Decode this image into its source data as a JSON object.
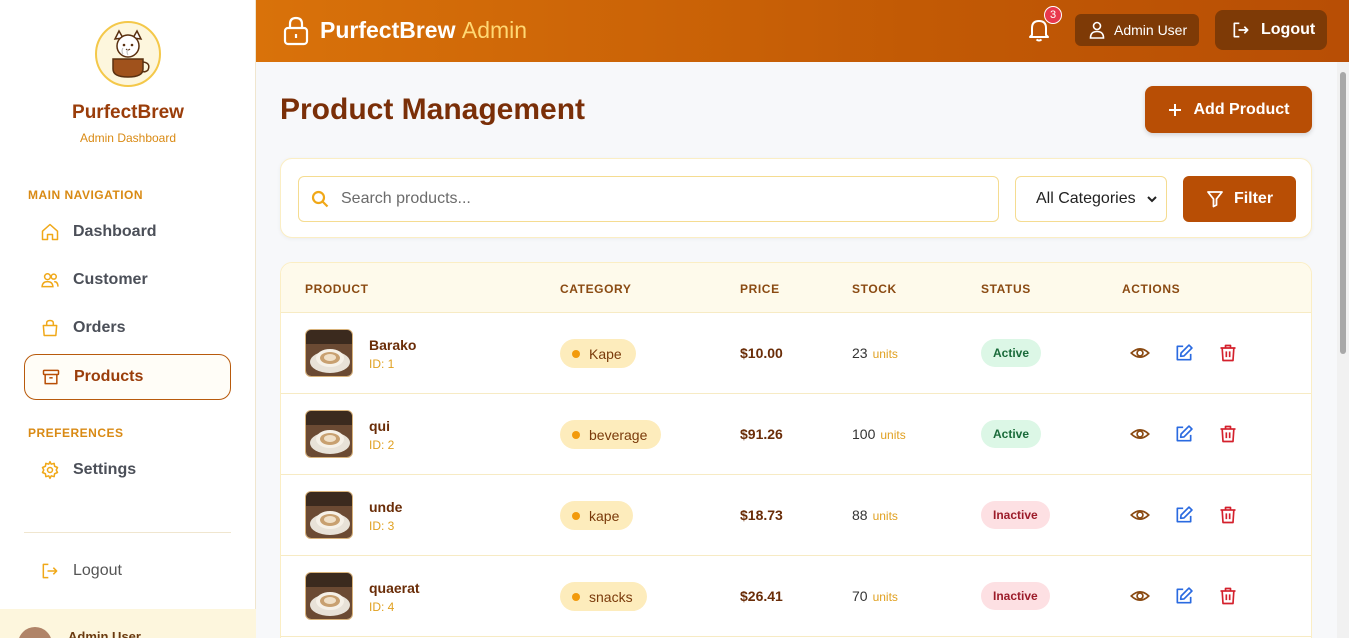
{
  "sidebar": {
    "brand_name": "PurfectBrew",
    "brand_sub": "Admin Dashboard",
    "main_nav_label": "MAIN NAVIGATION",
    "preferences_label": "PREFERENCES",
    "items": [
      {
        "label": "Dashboard",
        "icon": "home-icon"
      },
      {
        "label": "Customer",
        "icon": "users-icon"
      },
      {
        "label": "Orders",
        "icon": "shopping-bag-icon"
      },
      {
        "label": "Products",
        "icon": "archive-box-icon",
        "active": true
      }
    ],
    "settings_label": "Settings",
    "logout_label": "Logout",
    "user_name": "Admin User"
  },
  "header": {
    "title": "PurfectBrew",
    "title_suffix": "Admin",
    "notification_count": "3",
    "user_label": "Admin User",
    "logout_label": "Logout"
  },
  "main": {
    "page_title": "Product Management",
    "add_button_label": "Add Product",
    "search_placeholder": "Search products...",
    "category_select": "All Categories",
    "filter_label": "Filter",
    "columns": [
      "PRODUCT",
      "CATEGORY",
      "PRICE",
      "STOCK",
      "STATUS",
      "ACTIONS"
    ],
    "rows": [
      {
        "name": "Barako",
        "id": "ID: 1",
        "category": "Kape",
        "price": "$10.00",
        "stock": "23",
        "units": "units",
        "status": "Active"
      },
      {
        "name": "qui",
        "id": "ID: 2",
        "category": "beverage",
        "price": "$91.26",
        "stock": "100",
        "units": "units",
        "status": "Active"
      },
      {
        "name": "unde",
        "id": "ID: 3",
        "category": "kape",
        "price": "$18.73",
        "stock": "88",
        "units": "units",
        "status": "Inactive"
      },
      {
        "name": "quaerat",
        "id": "ID: 4",
        "category": "snacks",
        "price": "$26.41",
        "stock": "70",
        "units": "units",
        "status": "Inactive"
      }
    ]
  },
  "colors": {
    "brand": "#b84e05",
    "brand_dark": "#7a2f08",
    "accent": "#d98a14",
    "active_status": "#dcf7e6",
    "inactive_status": "#fde0e3"
  }
}
